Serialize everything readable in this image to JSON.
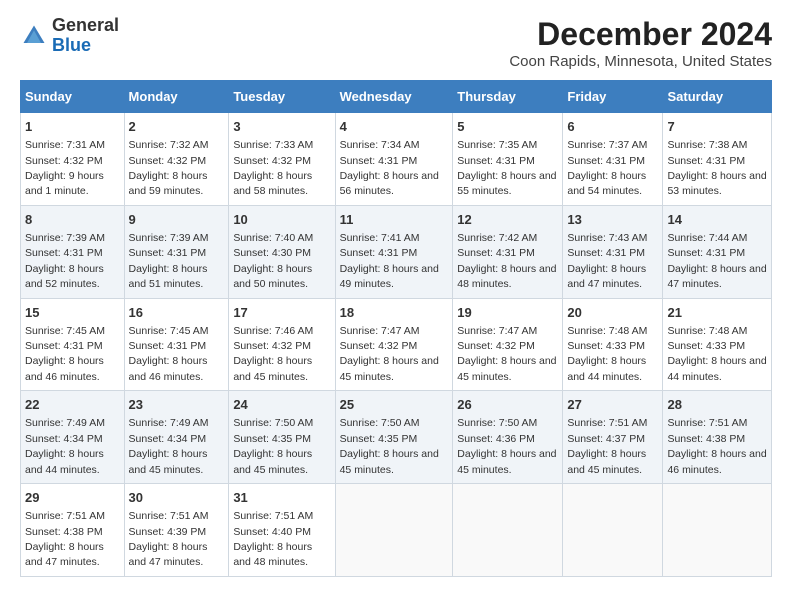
{
  "header": {
    "logo_line1": "General",
    "logo_line2": "Blue",
    "main_title": "December 2024",
    "subtitle": "Coon Rapids, Minnesota, United States"
  },
  "days_of_week": [
    "Sunday",
    "Monday",
    "Tuesday",
    "Wednesday",
    "Thursday",
    "Friday",
    "Saturday"
  ],
  "weeks": [
    [
      {
        "day": "1",
        "sunrise": "Sunrise: 7:31 AM",
        "sunset": "Sunset: 4:32 PM",
        "daylight": "Daylight: 9 hours and 1 minute."
      },
      {
        "day": "2",
        "sunrise": "Sunrise: 7:32 AM",
        "sunset": "Sunset: 4:32 PM",
        "daylight": "Daylight: 8 hours and 59 minutes."
      },
      {
        "day": "3",
        "sunrise": "Sunrise: 7:33 AM",
        "sunset": "Sunset: 4:32 PM",
        "daylight": "Daylight: 8 hours and 58 minutes."
      },
      {
        "day": "4",
        "sunrise": "Sunrise: 7:34 AM",
        "sunset": "Sunset: 4:31 PM",
        "daylight": "Daylight: 8 hours and 56 minutes."
      },
      {
        "day": "5",
        "sunrise": "Sunrise: 7:35 AM",
        "sunset": "Sunset: 4:31 PM",
        "daylight": "Daylight: 8 hours and 55 minutes."
      },
      {
        "day": "6",
        "sunrise": "Sunrise: 7:37 AM",
        "sunset": "Sunset: 4:31 PM",
        "daylight": "Daylight: 8 hours and 54 minutes."
      },
      {
        "day": "7",
        "sunrise": "Sunrise: 7:38 AM",
        "sunset": "Sunset: 4:31 PM",
        "daylight": "Daylight: 8 hours and 53 minutes."
      }
    ],
    [
      {
        "day": "8",
        "sunrise": "Sunrise: 7:39 AM",
        "sunset": "Sunset: 4:31 PM",
        "daylight": "Daylight: 8 hours and 52 minutes."
      },
      {
        "day": "9",
        "sunrise": "Sunrise: 7:39 AM",
        "sunset": "Sunset: 4:31 PM",
        "daylight": "Daylight: 8 hours and 51 minutes."
      },
      {
        "day": "10",
        "sunrise": "Sunrise: 7:40 AM",
        "sunset": "Sunset: 4:30 PM",
        "daylight": "Daylight: 8 hours and 50 minutes."
      },
      {
        "day": "11",
        "sunrise": "Sunrise: 7:41 AM",
        "sunset": "Sunset: 4:31 PM",
        "daylight": "Daylight: 8 hours and 49 minutes."
      },
      {
        "day": "12",
        "sunrise": "Sunrise: 7:42 AM",
        "sunset": "Sunset: 4:31 PM",
        "daylight": "Daylight: 8 hours and 48 minutes."
      },
      {
        "day": "13",
        "sunrise": "Sunrise: 7:43 AM",
        "sunset": "Sunset: 4:31 PM",
        "daylight": "Daylight: 8 hours and 47 minutes."
      },
      {
        "day": "14",
        "sunrise": "Sunrise: 7:44 AM",
        "sunset": "Sunset: 4:31 PM",
        "daylight": "Daylight: 8 hours and 47 minutes."
      }
    ],
    [
      {
        "day": "15",
        "sunrise": "Sunrise: 7:45 AM",
        "sunset": "Sunset: 4:31 PM",
        "daylight": "Daylight: 8 hours and 46 minutes."
      },
      {
        "day": "16",
        "sunrise": "Sunrise: 7:45 AM",
        "sunset": "Sunset: 4:31 PM",
        "daylight": "Daylight: 8 hours and 46 minutes."
      },
      {
        "day": "17",
        "sunrise": "Sunrise: 7:46 AM",
        "sunset": "Sunset: 4:32 PM",
        "daylight": "Daylight: 8 hours and 45 minutes."
      },
      {
        "day": "18",
        "sunrise": "Sunrise: 7:47 AM",
        "sunset": "Sunset: 4:32 PM",
        "daylight": "Daylight: 8 hours and 45 minutes."
      },
      {
        "day": "19",
        "sunrise": "Sunrise: 7:47 AM",
        "sunset": "Sunset: 4:32 PM",
        "daylight": "Daylight: 8 hours and 45 minutes."
      },
      {
        "day": "20",
        "sunrise": "Sunrise: 7:48 AM",
        "sunset": "Sunset: 4:33 PM",
        "daylight": "Daylight: 8 hours and 44 minutes."
      },
      {
        "day": "21",
        "sunrise": "Sunrise: 7:48 AM",
        "sunset": "Sunset: 4:33 PM",
        "daylight": "Daylight: 8 hours and 44 minutes."
      }
    ],
    [
      {
        "day": "22",
        "sunrise": "Sunrise: 7:49 AM",
        "sunset": "Sunset: 4:34 PM",
        "daylight": "Daylight: 8 hours and 44 minutes."
      },
      {
        "day": "23",
        "sunrise": "Sunrise: 7:49 AM",
        "sunset": "Sunset: 4:34 PM",
        "daylight": "Daylight: 8 hours and 45 minutes."
      },
      {
        "day": "24",
        "sunrise": "Sunrise: 7:50 AM",
        "sunset": "Sunset: 4:35 PM",
        "daylight": "Daylight: 8 hours and 45 minutes."
      },
      {
        "day": "25",
        "sunrise": "Sunrise: 7:50 AM",
        "sunset": "Sunset: 4:35 PM",
        "daylight": "Daylight: 8 hours and 45 minutes."
      },
      {
        "day": "26",
        "sunrise": "Sunrise: 7:50 AM",
        "sunset": "Sunset: 4:36 PM",
        "daylight": "Daylight: 8 hours and 45 minutes."
      },
      {
        "day": "27",
        "sunrise": "Sunrise: 7:51 AM",
        "sunset": "Sunset: 4:37 PM",
        "daylight": "Daylight: 8 hours and 45 minutes."
      },
      {
        "day": "28",
        "sunrise": "Sunrise: 7:51 AM",
        "sunset": "Sunset: 4:38 PM",
        "daylight": "Daylight: 8 hours and 46 minutes."
      }
    ],
    [
      {
        "day": "29",
        "sunrise": "Sunrise: 7:51 AM",
        "sunset": "Sunset: 4:38 PM",
        "daylight": "Daylight: 8 hours and 47 minutes."
      },
      {
        "day": "30",
        "sunrise": "Sunrise: 7:51 AM",
        "sunset": "Sunset: 4:39 PM",
        "daylight": "Daylight: 8 hours and 47 minutes."
      },
      {
        "day": "31",
        "sunrise": "Sunrise: 7:51 AM",
        "sunset": "Sunset: 4:40 PM",
        "daylight": "Daylight: 8 hours and 48 minutes."
      },
      null,
      null,
      null,
      null
    ]
  ]
}
